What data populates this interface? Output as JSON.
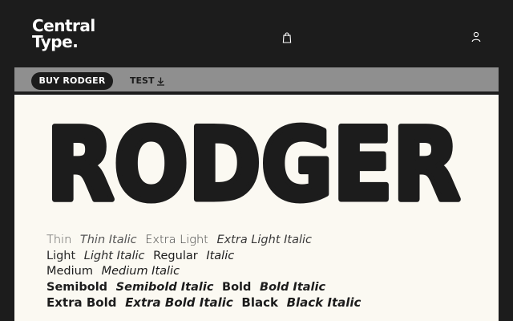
{
  "header": {
    "logo_line1": "Central",
    "logo_line2": "Type.",
    "icons": [
      "bag-icon",
      "user-icon"
    ]
  },
  "subbar": {
    "buy_label": "BUY RODGER",
    "test_label": "TEST",
    "test_icon": "download-icon"
  },
  "hero": {
    "title": "RODGER"
  },
  "styles": {
    "rows": [
      [
        "Thin",
        "Thin Italic",
        "Extra Light",
        "Extra Light Italic"
      ],
      [
        "Light",
        "Light Italic",
        "Regular",
        "Italic"
      ],
      [
        "Medium",
        "Medium Italic"
      ],
      [
        "Semibold",
        "Semibold Italic",
        "Bold",
        "Bold Italic"
      ],
      [
        "Extra Bold",
        "Extra Bold Italic",
        "Black",
        "Black Italic"
      ]
    ]
  },
  "colors": {
    "background": "#1c1c1c",
    "panel": "#fbf9f2",
    "subbar": "#8f8f8f",
    "text": "#1c1c1c"
  }
}
